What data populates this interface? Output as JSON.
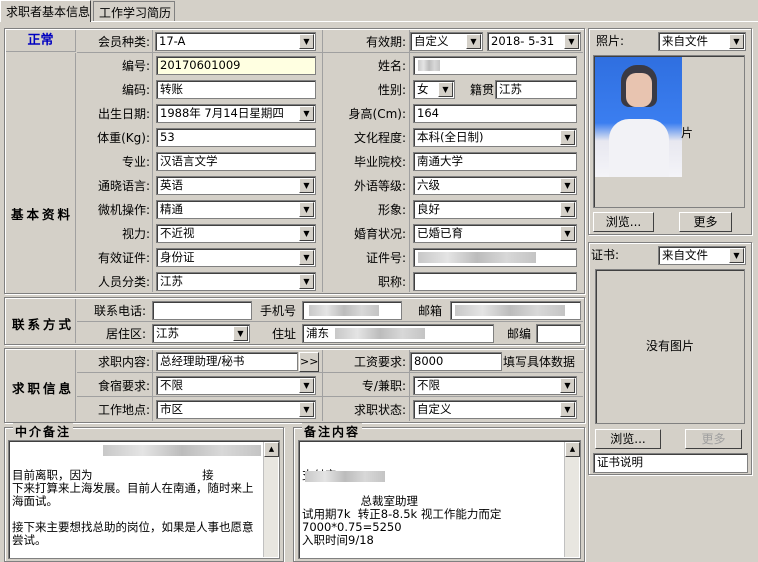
{
  "tabs": [
    "求职者基本信息",
    "工作学习简历"
  ],
  "status": "正常",
  "groups": {
    "basic": "基本资料",
    "contact": "联系方式",
    "job": "求职信息"
  },
  "fields": {
    "member_type": {
      "label": "会员种类:",
      "value": "17-A"
    },
    "validity": {
      "label": "有效期:",
      "mode": "自定义",
      "date": "2018- 5-31"
    },
    "number": {
      "label": "编号:",
      "value": "20170601009"
    },
    "name": {
      "label": "姓名:",
      "value": ""
    },
    "code": {
      "label": "编码:",
      "value": "转账"
    },
    "gender": {
      "label": "性别:",
      "value": "女"
    },
    "native": {
      "label": "籍贯",
      "value": "江苏"
    },
    "birth": {
      "label": "出生日期:",
      "value": "1988年 7月14日星期四"
    },
    "height": {
      "label": "身高(Cm):",
      "value": "164"
    },
    "weight": {
      "label": "体重(Kg):",
      "value": "53"
    },
    "education": {
      "label": "文化程度:",
      "value": "本科(全日制)"
    },
    "major": {
      "label": "专业:",
      "value": "汉语言文学"
    },
    "school": {
      "label": "毕业院校:",
      "value": "南通大学"
    },
    "language": {
      "label": "通晓语言:",
      "value": "英语"
    },
    "lang_level": {
      "label": "外语等级:",
      "value": "六级"
    },
    "computer": {
      "label": "微机操作:",
      "value": "精通"
    },
    "image": {
      "label": "形象:",
      "value": "良好"
    },
    "vision": {
      "label": "视力:",
      "value": "不近视"
    },
    "marital": {
      "label": "婚育状况:",
      "value": "已婚已育"
    },
    "id_type": {
      "label": "有效证件:",
      "value": "身份证"
    },
    "id_no": {
      "label": "证件号:",
      "value": ""
    },
    "category": {
      "label": "人员分类:",
      "value": "江苏"
    },
    "title": {
      "label": "职称:",
      "value": ""
    },
    "phone": {
      "label": "联系电话:",
      "value": ""
    },
    "mobile": {
      "label": "手机号",
      "value": ""
    },
    "email": {
      "label": "邮箱",
      "value": ""
    },
    "area": {
      "label": "居住区:",
      "value": "江苏"
    },
    "address": {
      "label": "住址",
      "value": "浦东"
    },
    "postcode": {
      "label": "邮编",
      "value": ""
    },
    "job_content": {
      "label": "求职内容:",
      "value": "总经理助理/秘书"
    },
    "salary": {
      "label": "工资要求:",
      "value": "8000",
      "hint": "填写具体数据"
    },
    "board": {
      "label": "食宿要求:",
      "value": "不限"
    },
    "fulltime": {
      "label": "专/兼职:",
      "value": "不限"
    },
    "location": {
      "label": "工作地点:",
      "value": "市区"
    },
    "job_state": {
      "label": "求职状态:",
      "value": "自定义"
    }
  },
  "photo": {
    "label": "照片:",
    "source": "来自文件",
    "caption": "片",
    "browse": "浏览...",
    "more": "更多"
  },
  "cert": {
    "label": "证书:",
    "source": "来自文件",
    "empty": "没有图片",
    "browse": "浏览...",
    "more": "更多",
    "desc": "证书说明"
  },
  "memo_agent": {
    "title": "中介备注",
    "text": "目前离职，因为                              接\n下来打算来上海发展。目前人在南通，随时来上\n海面试。\n\n接下来主要想找总助的岗位，如果是人事也愿意\n尝试。"
  },
  "memo_note": {
    "title": "备注内容",
    "text": "支付宝\n\n                总裁室助理\n试用期7k  转正8-8.5k 视工作能力而定\n7000*0.75=5250\n入职时间9/18"
  },
  "colors": {
    "status": "#0000c0",
    "bg": "#d4d0c8"
  }
}
